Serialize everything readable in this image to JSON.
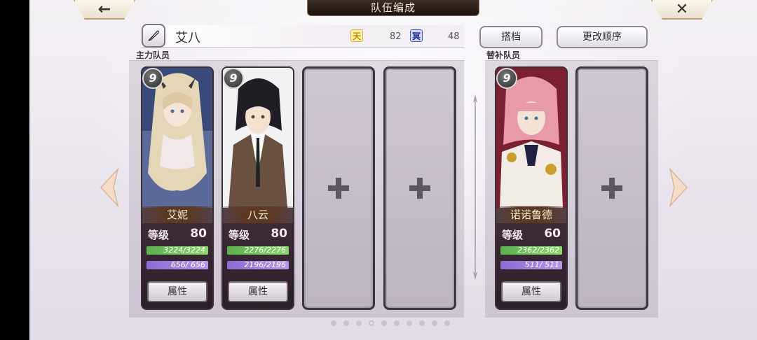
{
  "header": {
    "title": "队伍编成",
    "back_icon": "←",
    "close_icon": "✕"
  },
  "team": {
    "name": "艾八",
    "heaven_icon": "天",
    "heaven_value": "82",
    "dark_icon": "冥",
    "dark_value": "48",
    "edit_icon": "quill-icon"
  },
  "buttons": {
    "partner": "搭档",
    "change_order": "更改顺序"
  },
  "sections": {
    "main": "主力队员",
    "sub": "替补队员"
  },
  "main_members": [
    {
      "rank": "9",
      "name": "艾妮",
      "level_label": "等级",
      "level": "80",
      "hp": "3224/3224",
      "mp": "656/ 656",
      "attr": "属性"
    },
    {
      "rank": "9",
      "name": "八云",
      "level_label": "等级",
      "level": "80",
      "hp": "2276/2276",
      "mp": "2196/2196",
      "attr": "属性"
    }
  ],
  "sub_members": [
    {
      "rank": "9",
      "name": "诺诺鲁德",
      "level_label": "等级",
      "level": "60",
      "hp": "2362/2362",
      "mp": "511/ 511",
      "attr": "属性"
    }
  ],
  "empty_slot_icon": "+",
  "pagination": {
    "total": 10,
    "active": 4
  },
  "colors": {
    "hp": "#6cc052",
    "mp": "#9d7fe0",
    "name_plate": "#5a3a24"
  }
}
